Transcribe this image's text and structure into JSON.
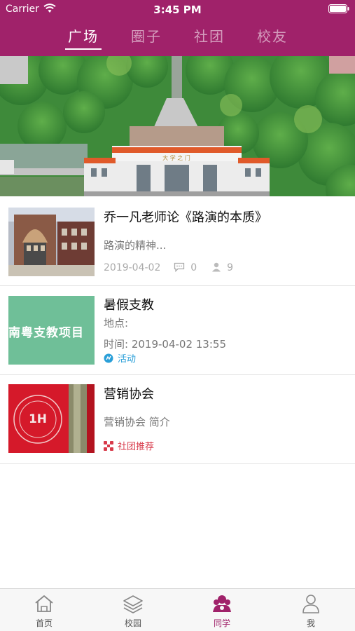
{
  "status_bar": {
    "carrier": "Carrier",
    "time": "3:45 PM"
  },
  "top_tabs": [
    {
      "label": "广场",
      "active": true
    },
    {
      "label": "圈子",
      "active": false
    },
    {
      "label": "社团",
      "active": false
    },
    {
      "label": "校友",
      "active": false
    }
  ],
  "banner": {
    "gate_sign": "大 学 之 门"
  },
  "feed": [
    {
      "title": "乔一凡老师论《路演的本质》",
      "summary": "路演的精神...",
      "date": "2019-04-02",
      "comments": "0",
      "participants": "9"
    },
    {
      "title": "暑假支教",
      "thumb_text": "南粤支教项目",
      "location": "地点:",
      "time": "时间:  2019-04-02 13:55",
      "tag": "活动"
    },
    {
      "title": "营销协会",
      "summary": "营销协会  简介",
      "tag": "社团推荐",
      "logo_text": "1H"
    }
  ],
  "tabbar": [
    {
      "label": "首页",
      "icon": "home-icon"
    },
    {
      "label": "校园",
      "icon": "layers-icon"
    },
    {
      "label": "同学",
      "icon": "classmates-icon",
      "active": true
    },
    {
      "label": "我",
      "icon": "person-icon"
    }
  ],
  "colors": {
    "brand": "#a0226a",
    "activity_tag": "#2a9fd8",
    "club_tag": "#d83a4a"
  }
}
